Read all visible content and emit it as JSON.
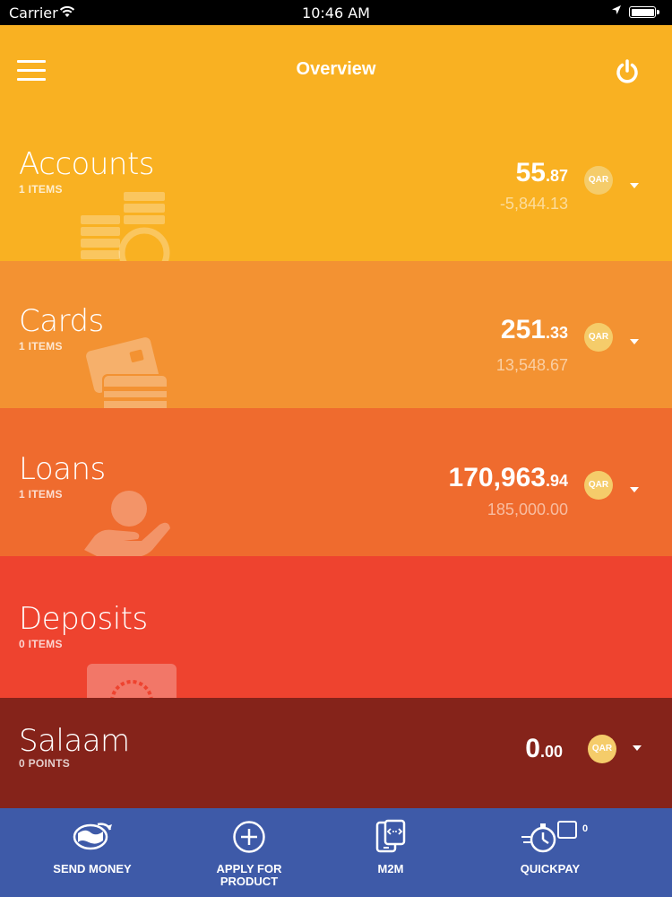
{
  "status_bar": {
    "carrier": "Carrier",
    "time": "10:46 AM",
    "wifi_icon": "wifi-icon",
    "location_icon": "location-arrow-icon",
    "battery_level": 1.0
  },
  "header": {
    "title": "Overview",
    "menu_icon": "hamburger-menu-icon",
    "power_icon": "power-icon",
    "background": "#F9B122"
  },
  "sections": {
    "accounts": {
      "title": "Accounts",
      "subtitle": "1 ITEMS",
      "amount_int": "55",
      "amount_dec": ".87",
      "secondary": "-5,844.13",
      "currency": "QAR",
      "color": "#F9B122",
      "icon": "coins-icon"
    },
    "cards": {
      "title": "Cards",
      "subtitle": "1 ITEMS",
      "amount_int": "251",
      "amount_dec": ".33",
      "secondary": "13,548.67",
      "currency": "QAR",
      "color": "#F39232",
      "icon": "cards-icon"
    },
    "loans": {
      "title": "Loans",
      "subtitle": "1 ITEMS",
      "amount_int": "170,963",
      "amount_dec": ".94",
      "secondary": "185,000.00",
      "currency": "QAR",
      "color": "#EF6B2E",
      "icon": "hand-coin-icon"
    },
    "deposits": {
      "title": "Deposits",
      "subtitle": "0 ITEMS",
      "color": "#EE432F",
      "icon": "safe-icon"
    },
    "salaam": {
      "title": "Salaam",
      "subtitle": "0  POINTS",
      "amount_int": "0",
      "amount_dec": ".00",
      "currency": "QAR",
      "color": "#85231A"
    }
  },
  "tab_bar": {
    "background": "#3E5AA8",
    "tabs": [
      {
        "label": "SEND MONEY",
        "icon": "globe-transfer-icon"
      },
      {
        "label": "APPLY FOR PRODUCT",
        "icon": "plus-circle-icon"
      },
      {
        "label": "M2M",
        "icon": "phone-transfer-icon"
      },
      {
        "label": "QUICKPAY",
        "icon": "stopwatch-icon",
        "badge": "0"
      }
    ]
  }
}
